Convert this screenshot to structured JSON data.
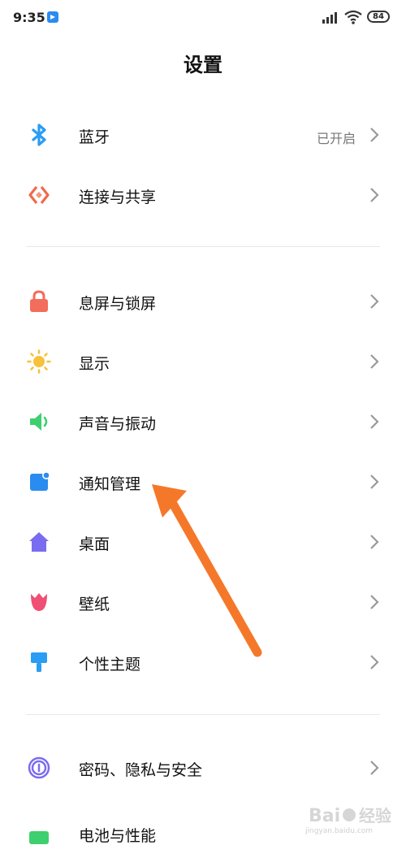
{
  "status_bar": {
    "time": "9:35",
    "battery": "84"
  },
  "page": {
    "title": "设置"
  },
  "items": [
    {
      "label": "蓝牙",
      "value": "已开启",
      "icon": "bluetooth-icon"
    },
    {
      "label": "连接与共享",
      "icon": "connection-share-icon"
    },
    {
      "label": "息屏与锁屏",
      "icon": "lock-icon"
    },
    {
      "label": "显示",
      "icon": "sun-icon"
    },
    {
      "label": "声音与振动",
      "icon": "speaker-icon"
    },
    {
      "label": "通知管理",
      "icon": "notification-icon"
    },
    {
      "label": "桌面",
      "icon": "home-icon"
    },
    {
      "label": "壁纸",
      "icon": "tulip-icon"
    },
    {
      "label": "个性主题",
      "icon": "brush-icon"
    },
    {
      "label": "密码、隐私与安全",
      "icon": "fingerprint-icon"
    },
    {
      "label": "电池与性能",
      "icon": "battery-icon"
    }
  ],
  "watermark": {
    "text": "jingyan.baidu.com"
  },
  "colors": {
    "bluetooth": "#2a9df4",
    "connection": "#f06a4a",
    "lock": "#f26d5b",
    "display": "#f7c23a",
    "sound": "#3ecf6e",
    "notification": "#2a8cf0",
    "home": "#7a6cf0",
    "wallpaper": "#ef4f74",
    "theme": "#2a9df4",
    "privacy": "#7a6cf0",
    "battery": "#3ecf6e",
    "annotation_arrow": "#f5782a"
  }
}
